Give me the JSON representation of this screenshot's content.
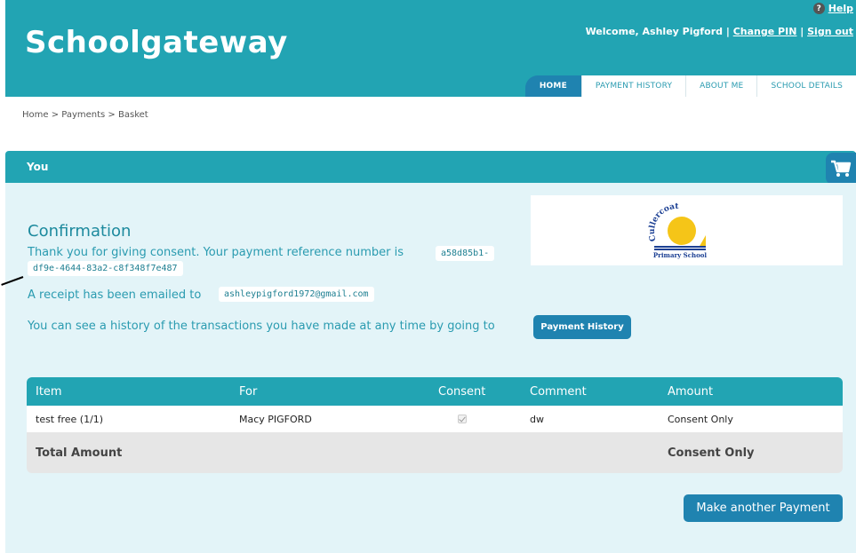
{
  "header": {
    "logo": "Schoolgateway",
    "help": "Help",
    "welcome": "Welcome, Ashley Pigford |",
    "change_pin": "Change PIN",
    "separator": "|",
    "sign_out": "Sign out",
    "tabs": [
      "HOME",
      "PAYMENT HISTORY",
      "ABOUT ME",
      "SCHOOL DETAILS"
    ],
    "active_tab": "HOME"
  },
  "breadcrumb": "Home  >  Payments  >  Basket",
  "panel": {
    "title": "You"
  },
  "school_logo": {
    "name_arc": "Cullercoats",
    "label": "Primary School"
  },
  "confirmation": {
    "title": "Confirmation",
    "line1": "Thank you for giving consent. Your payment reference number is",
    "reference_part1": "a58d85b1-",
    "reference_part2": "df9e-4644-83a2-c8f348f7e487",
    "receipt_text": "A receipt has been emailed to",
    "email": "ashleypigford1972@gmail.com",
    "history_text": "You can see a history of the transactions you have made at any time by going to",
    "history_button": "Payment History"
  },
  "table": {
    "headers": [
      "Item",
      "For",
      "Consent",
      "Comment",
      "Amount"
    ],
    "rows": [
      {
        "item": "test free (1/1)",
        "for": "Macy PIGFORD",
        "consent": true,
        "comment": "dw",
        "amount": "Consent Only"
      }
    ],
    "total_label": "Total Amount",
    "total_value": "Consent Only"
  },
  "actions": {
    "make_another": "Make another Payment"
  },
  "colors": {
    "teal": "#22a4b3",
    "blue": "#1f83b0",
    "panel_bg": "#e3f4f8"
  }
}
